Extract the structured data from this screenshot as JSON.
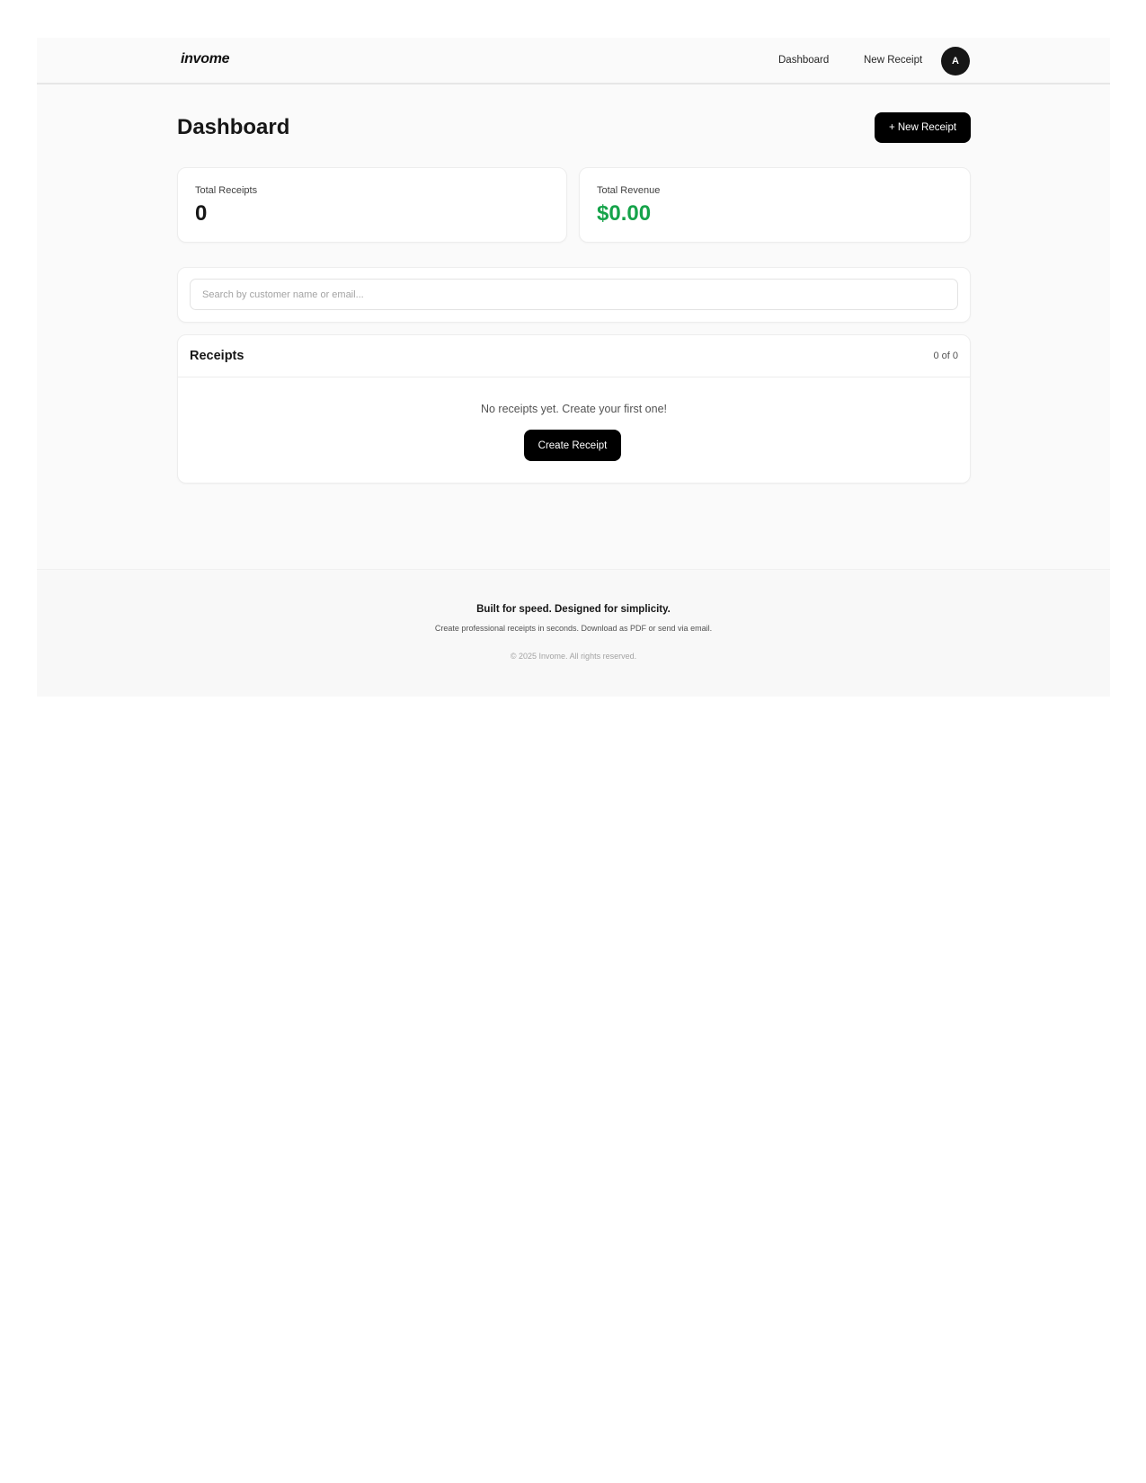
{
  "header": {
    "logo": "invome",
    "nav": [
      {
        "label": "Dashboard"
      },
      {
        "label": "New Receipt"
      }
    ],
    "avatar_initial": "A"
  },
  "page": {
    "title": "Dashboard",
    "new_receipt_button": "+ New Receipt"
  },
  "stats": {
    "total_receipts": {
      "label": "Total Receipts",
      "value": "0"
    },
    "total_revenue": {
      "label": "Total Revenue",
      "value": "$0.00",
      "color": "#16a34a"
    }
  },
  "search": {
    "placeholder": "Search by customer name or email...",
    "value": ""
  },
  "receipts": {
    "title": "Receipts",
    "count": "0 of 0",
    "empty_message": "No receipts yet. Create your first one!",
    "create_button": "Create Receipt"
  },
  "footer": {
    "tagline": "Built for speed. Designed for simplicity.",
    "subtitle": "Create professional receipts in seconds. Download as PDF or send via email.",
    "copyright": "© 2025 Invome. All rights reserved."
  },
  "colors": {
    "primary_button": "#000000",
    "revenue": "#16a34a",
    "background": "#fafafa"
  }
}
